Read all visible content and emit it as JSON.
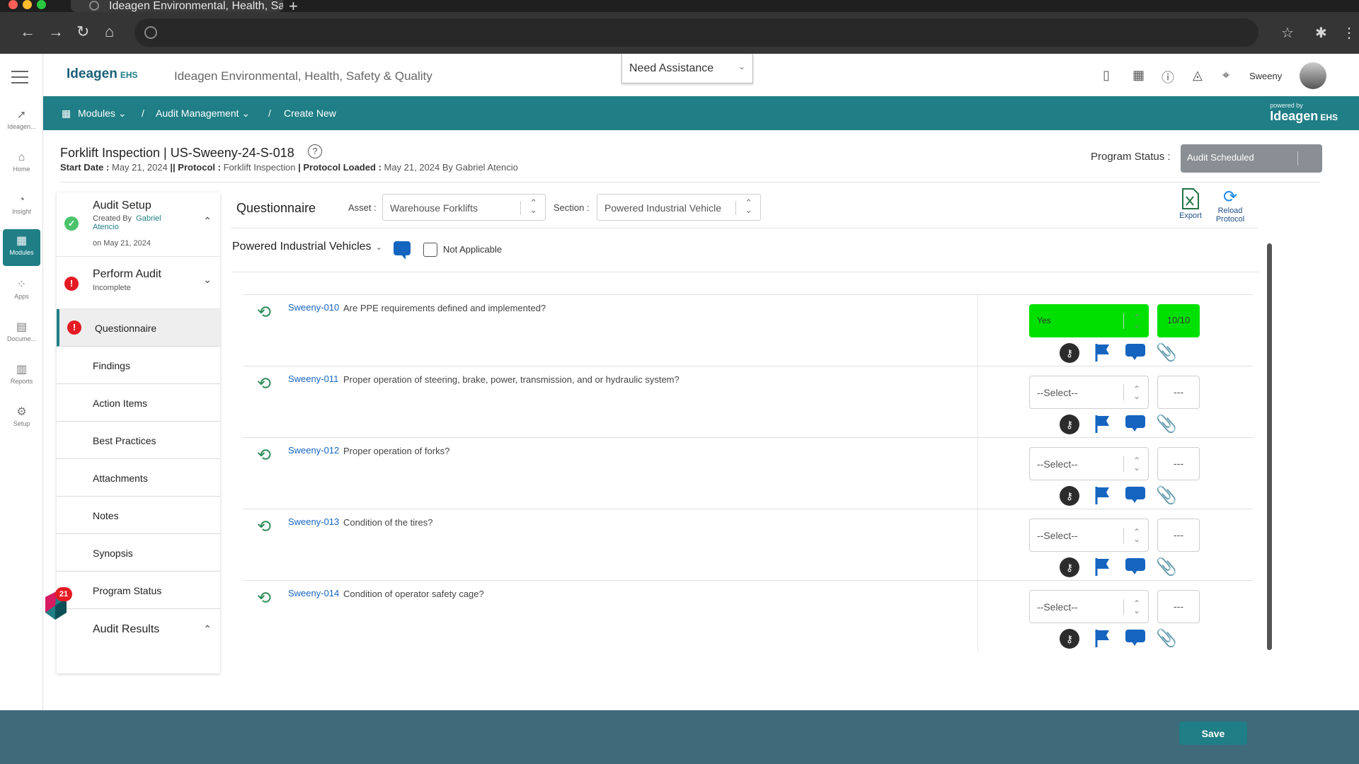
{
  "browser": {
    "tab_title": "Ideagen Environmental, Health, Sa",
    "new_tab": "+"
  },
  "header": {
    "logo": "Ideagen",
    "logo_suffix": "EHS",
    "app_title": "Ideagen Environmental, Health, Safety & Quality",
    "assistance": "Need Assistance",
    "user_name": "Sweeny"
  },
  "rail": {
    "items": [
      {
        "label": "Ideagen...",
        "icon": "ideagen-icon"
      },
      {
        "label": "Home",
        "icon": "home-icon"
      },
      {
        "label": "Insight",
        "icon": "insight-icon"
      },
      {
        "label": "Modules",
        "icon": "modules-icon"
      },
      {
        "label": "Apps",
        "icon": "apps-icon"
      },
      {
        "label": "Docume...",
        "icon": "document-icon"
      },
      {
        "label": "Reports",
        "icon": "reports-icon"
      },
      {
        "label": "Setup",
        "icon": "setup-icon"
      }
    ]
  },
  "breadcrumb": {
    "modules": "Modules",
    "audit_mgmt": "Audit Management",
    "create_new": "Create New",
    "sep": "/",
    "powered_by": "powered by",
    "powered_logo": "Ideagen",
    "powered_suffix": "EHS"
  },
  "page": {
    "title": "Forklift Inspection | US-Sweeny-24-S-018",
    "help": "?",
    "start_label": "Start Date :",
    "start_value": "May 21, 2024",
    "sep": "||",
    "protocol_label": "Protocol :",
    "protocol_value": "Forklift Inspection",
    "pipe": "|",
    "loaded_label": "Protocol Loaded :",
    "loaded_value": "May 21, 2024 By Gabriel Atencio",
    "program_status_label": "Program Status :",
    "program_status_value": "Audit Scheduled"
  },
  "left_nav": {
    "audit_setup": {
      "title": "Audit Setup",
      "created_by": "Created By",
      "author_first": "Gabriel",
      "author_last": "Atencio",
      "date": "on May 21, 2024"
    },
    "perform_audit": {
      "title": "Perform Audit",
      "status": "Incomplete"
    },
    "items": [
      "Questionnaire",
      "Findings",
      "Action Items",
      "Best Practices",
      "Attachments",
      "Notes",
      "Synopsis",
      "Program Status"
    ],
    "audit_results": "Audit Results",
    "chat_badge": "21"
  },
  "questionnaire": {
    "heading": "Questionnaire",
    "asset_label": "Asset :",
    "asset_value": "Warehouse Forklifts",
    "section_label": "Section :",
    "section_value": "Powered Industrial Vehicle",
    "export": "Export",
    "reload_1": "Reload",
    "reload_2": "Protocol",
    "subsection": "Powered Industrial Vehicles",
    "not_applicable": "Not Applicable",
    "questions": [
      {
        "code": "Sweeny-010",
        "text": "Are PPE requirements defined and implemented?",
        "answer": "Yes",
        "score": "10/10"
      },
      {
        "code": "Sweeny-011",
        "text": "Proper operation of steering, brake, power, transmission, and or hydraulic system?",
        "answer": "--Select--",
        "score": "---"
      },
      {
        "code": "Sweeny-012",
        "text": "Proper operation of forks?",
        "answer": "--Select--",
        "score": "---"
      },
      {
        "code": "Sweeny-013",
        "text": "Condition of the tires?",
        "answer": "--Select--",
        "score": "---"
      },
      {
        "code": "Sweeny-014",
        "text": "Condition of operator safety cage?",
        "answer": "--Select--",
        "score": "---"
      }
    ],
    "save": "Save"
  },
  "colors": {
    "brand_teal": "#1f7e86",
    "answer_green": "#00e000",
    "action_blue": "#1565c0",
    "error_red": "#e41b23"
  }
}
